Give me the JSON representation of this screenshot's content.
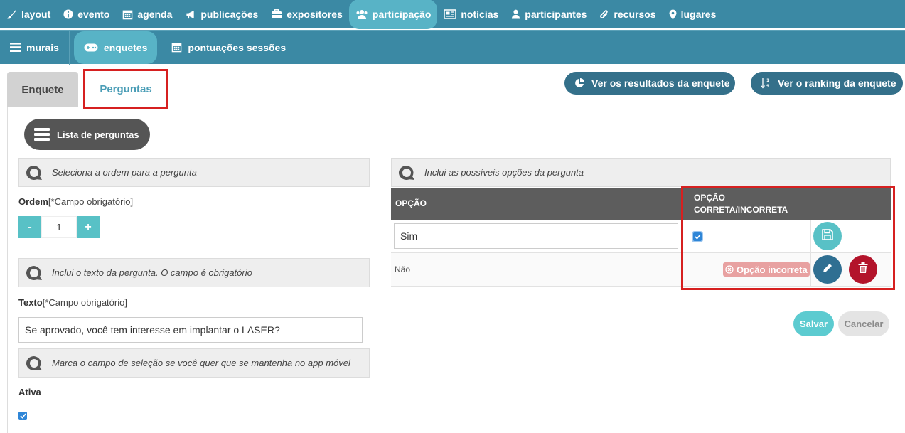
{
  "topnav": [
    {
      "label": "layout",
      "icon": "brush-icon"
    },
    {
      "label": "evento",
      "icon": "info-icon"
    },
    {
      "label": "agenda",
      "icon": "calendar-icon"
    },
    {
      "label": "publicações",
      "icon": "megaphone-icon"
    },
    {
      "label": "expositores",
      "icon": "briefcase-icon"
    },
    {
      "label": "participação",
      "icon": "users-icon",
      "active": true
    },
    {
      "label": "notícias",
      "icon": "newspaper-icon"
    },
    {
      "label": "participantes",
      "icon": "user-icon"
    },
    {
      "label": "recursos",
      "icon": "paperclip-icon"
    },
    {
      "label": "lugares",
      "icon": "map-pin-icon"
    }
  ],
  "subnav": [
    {
      "label": "murais",
      "icon": "bars-icon"
    },
    {
      "label": "enquetes",
      "icon": "gamepad-icon",
      "active": true
    },
    {
      "label": "pontuações sessões",
      "icon": "calendar-icon"
    }
  ],
  "tabs": {
    "enquete": "Enquete",
    "perguntas": "Perguntas"
  },
  "header_buttons": {
    "results": "Ver os resultados da enquete",
    "ranking": "Ver o ranking da enquete"
  },
  "lista_button": "Lista de perguntas",
  "left": {
    "order_hint": "Seleciona a ordem para a pergunta",
    "order_label": "Ordem",
    "order_required": "[*Campo obrigatório]",
    "stepper": {
      "minus": "-",
      "value": "1",
      "plus": "+"
    },
    "text_hint": "Inclui o texto da pergunta. O campo é obrigatório",
    "text_label": "Texto",
    "text_required": "[*Campo obrigatório]",
    "text_value": "Se aprovado, você tem interesse em implantar o LASER?",
    "active_hint": "Marca o campo de seleção se você quer que se mantenha no app móvel",
    "active_label": "Ativa"
  },
  "right": {
    "options_hint": "Inclui as possíveis opções da pergunta",
    "col_option": "OPÇÃO",
    "col_correct_line1": "OPÇÃO",
    "col_correct_line2": "CORRETA/INCORRETA",
    "rows": [
      {
        "option": "Sim",
        "correct": true
      },
      {
        "option": "Não",
        "badge": "Opção incorreta"
      }
    ],
    "save": "Salvar",
    "cancel": "Cancelar"
  },
  "colors": {
    "nav": "#3b89a4",
    "nav_active": "#58b3c6",
    "pill": "#34708a",
    "teal": "#58c1c6",
    "edit": "#2f6f92",
    "delete": "#b3142b",
    "highlight": "#d62020"
  }
}
